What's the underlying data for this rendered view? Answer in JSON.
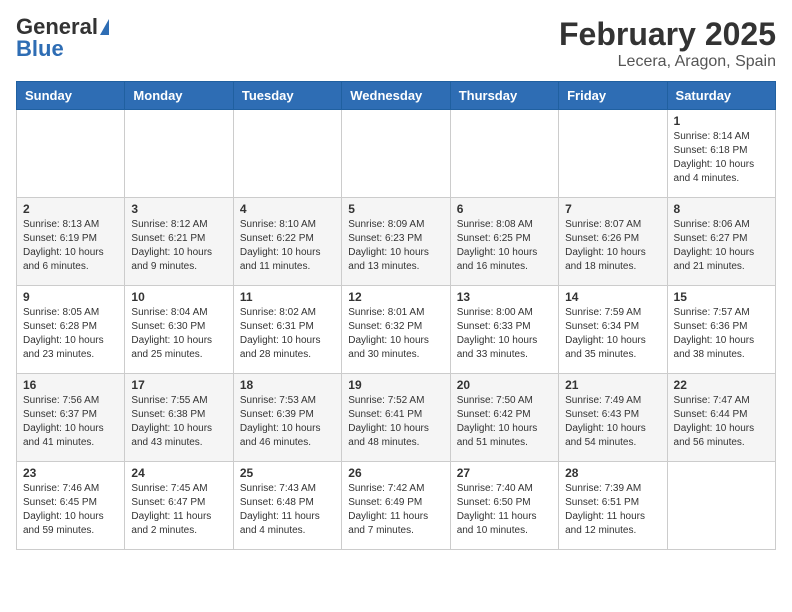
{
  "header": {
    "logo_general": "General",
    "logo_blue": "Blue",
    "title": "February 2025",
    "subtitle": "Lecera, Aragon, Spain"
  },
  "weekdays": [
    "Sunday",
    "Monday",
    "Tuesday",
    "Wednesday",
    "Thursday",
    "Friday",
    "Saturday"
  ],
  "weeks": [
    [
      {
        "day": "",
        "info": ""
      },
      {
        "day": "",
        "info": ""
      },
      {
        "day": "",
        "info": ""
      },
      {
        "day": "",
        "info": ""
      },
      {
        "day": "",
        "info": ""
      },
      {
        "day": "",
        "info": ""
      },
      {
        "day": "1",
        "info": "Sunrise: 8:14 AM\nSunset: 6:18 PM\nDaylight: 10 hours and 4 minutes."
      }
    ],
    [
      {
        "day": "2",
        "info": "Sunrise: 8:13 AM\nSunset: 6:19 PM\nDaylight: 10 hours and 6 minutes."
      },
      {
        "day": "3",
        "info": "Sunrise: 8:12 AM\nSunset: 6:21 PM\nDaylight: 10 hours and 9 minutes."
      },
      {
        "day": "4",
        "info": "Sunrise: 8:10 AM\nSunset: 6:22 PM\nDaylight: 10 hours and 11 minutes."
      },
      {
        "day": "5",
        "info": "Sunrise: 8:09 AM\nSunset: 6:23 PM\nDaylight: 10 hours and 13 minutes."
      },
      {
        "day": "6",
        "info": "Sunrise: 8:08 AM\nSunset: 6:25 PM\nDaylight: 10 hours and 16 minutes."
      },
      {
        "day": "7",
        "info": "Sunrise: 8:07 AM\nSunset: 6:26 PM\nDaylight: 10 hours and 18 minutes."
      },
      {
        "day": "8",
        "info": "Sunrise: 8:06 AM\nSunset: 6:27 PM\nDaylight: 10 hours and 21 minutes."
      }
    ],
    [
      {
        "day": "9",
        "info": "Sunrise: 8:05 AM\nSunset: 6:28 PM\nDaylight: 10 hours and 23 minutes."
      },
      {
        "day": "10",
        "info": "Sunrise: 8:04 AM\nSunset: 6:30 PM\nDaylight: 10 hours and 25 minutes."
      },
      {
        "day": "11",
        "info": "Sunrise: 8:02 AM\nSunset: 6:31 PM\nDaylight: 10 hours and 28 minutes."
      },
      {
        "day": "12",
        "info": "Sunrise: 8:01 AM\nSunset: 6:32 PM\nDaylight: 10 hours and 30 minutes."
      },
      {
        "day": "13",
        "info": "Sunrise: 8:00 AM\nSunset: 6:33 PM\nDaylight: 10 hours and 33 minutes."
      },
      {
        "day": "14",
        "info": "Sunrise: 7:59 AM\nSunset: 6:34 PM\nDaylight: 10 hours and 35 minutes."
      },
      {
        "day": "15",
        "info": "Sunrise: 7:57 AM\nSunset: 6:36 PM\nDaylight: 10 hours and 38 minutes."
      }
    ],
    [
      {
        "day": "16",
        "info": "Sunrise: 7:56 AM\nSunset: 6:37 PM\nDaylight: 10 hours and 41 minutes."
      },
      {
        "day": "17",
        "info": "Sunrise: 7:55 AM\nSunset: 6:38 PM\nDaylight: 10 hours and 43 minutes."
      },
      {
        "day": "18",
        "info": "Sunrise: 7:53 AM\nSunset: 6:39 PM\nDaylight: 10 hours and 46 minutes."
      },
      {
        "day": "19",
        "info": "Sunrise: 7:52 AM\nSunset: 6:41 PM\nDaylight: 10 hours and 48 minutes."
      },
      {
        "day": "20",
        "info": "Sunrise: 7:50 AM\nSunset: 6:42 PM\nDaylight: 10 hours and 51 minutes."
      },
      {
        "day": "21",
        "info": "Sunrise: 7:49 AM\nSunset: 6:43 PM\nDaylight: 10 hours and 54 minutes."
      },
      {
        "day": "22",
        "info": "Sunrise: 7:47 AM\nSunset: 6:44 PM\nDaylight: 10 hours and 56 minutes."
      }
    ],
    [
      {
        "day": "23",
        "info": "Sunrise: 7:46 AM\nSunset: 6:45 PM\nDaylight: 10 hours and 59 minutes."
      },
      {
        "day": "24",
        "info": "Sunrise: 7:45 AM\nSunset: 6:47 PM\nDaylight: 11 hours and 2 minutes."
      },
      {
        "day": "25",
        "info": "Sunrise: 7:43 AM\nSunset: 6:48 PM\nDaylight: 11 hours and 4 minutes."
      },
      {
        "day": "26",
        "info": "Sunrise: 7:42 AM\nSunset: 6:49 PM\nDaylight: 11 hours and 7 minutes."
      },
      {
        "day": "27",
        "info": "Sunrise: 7:40 AM\nSunset: 6:50 PM\nDaylight: 11 hours and 10 minutes."
      },
      {
        "day": "28",
        "info": "Sunrise: 7:39 AM\nSunset: 6:51 PM\nDaylight: 11 hours and 12 minutes."
      },
      {
        "day": "",
        "info": ""
      }
    ]
  ]
}
